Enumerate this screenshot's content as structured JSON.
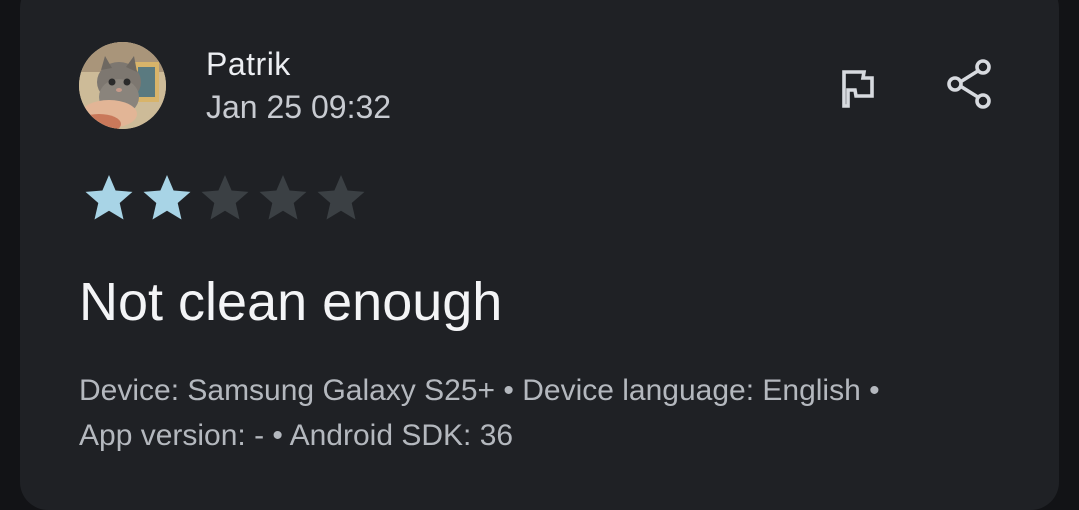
{
  "review": {
    "author": "Patrik",
    "date": "Jan 25 09:32",
    "rating": 2,
    "max_rating": 5,
    "title": "Not clean enough",
    "meta_line1": "Device: Samsung Galaxy S25+ • Device language: English •",
    "meta_line2": "App version: - • Android SDK: 36"
  },
  "icons": {
    "avatar": "avatar-cat-photo",
    "flag": "flag-icon",
    "share": "share-icon",
    "star_filled": "star-filled-icon",
    "star_empty": "star-empty-icon"
  },
  "colors": {
    "background": "#1f2125",
    "star_filled": "#a8d4e6",
    "star_empty": "#3b4044",
    "icon": "#d7dadf"
  }
}
